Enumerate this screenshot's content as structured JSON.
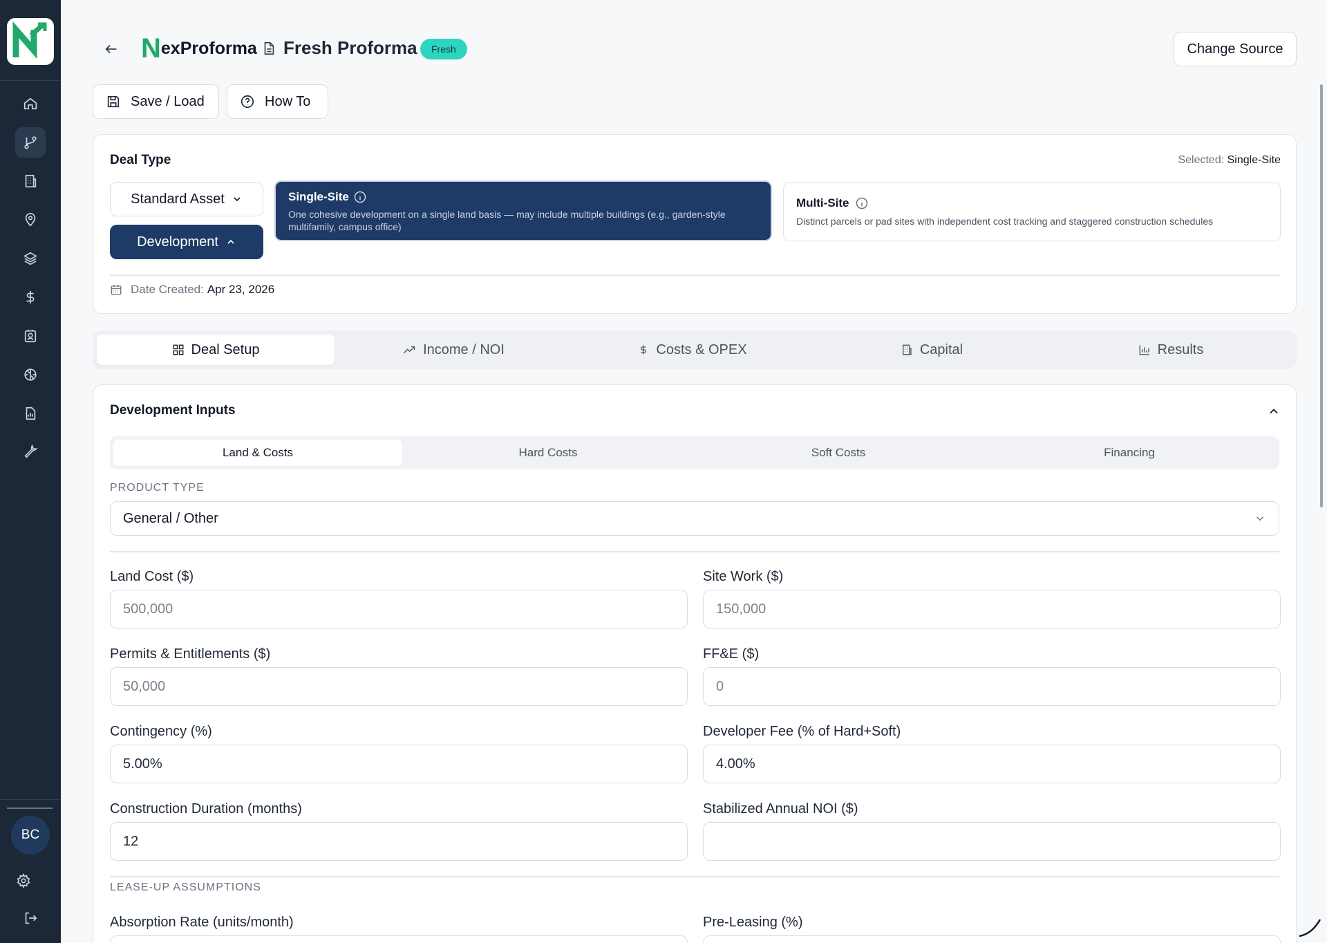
{
  "sidebar": {
    "logo_letter": "N",
    "nav": [
      "home-icon",
      "git-branch-icon",
      "building-icon",
      "map-pin-icon",
      "layers-icon",
      "dollar-icon",
      "badge-icon",
      "brain-icon",
      "report-icon",
      "wrench-icon"
    ],
    "avatar_initials": "BC"
  },
  "header": {
    "brand_n": "N",
    "brand_rest": "exProforma",
    "doc_title": "Fresh Proforma",
    "badge": "Fresh",
    "change_source": "Change Source",
    "save_load": "Save / Load",
    "how_to": "How To"
  },
  "deal": {
    "title": "Deal Type",
    "selected_label": "Selected:",
    "selected_value": "Single-Site",
    "asset_dropdown": "Standard Asset",
    "mode_dropdown": "Development",
    "single_title": "Single-Site",
    "single_desc": "One cohesive development on a single land basis — may include multiple buildings (e.g., garden-style multifamily, campus office)",
    "multi_title": "Multi-Site",
    "multi_desc": "Distinct parcels or pad sites with independent cost tracking and staggered construction schedules",
    "date_label": "Date Created:",
    "date_value": "Apr 23, 2026"
  },
  "tabs": [
    "Deal Setup",
    "Income / NOI",
    "Costs & OPEX",
    "Capital",
    "Results"
  ],
  "dev": {
    "title": "Development Inputs",
    "subtabs": [
      "Land & Costs",
      "Hard Costs",
      "Soft Costs",
      "Financing"
    ],
    "product_type_label": "PRODUCT TYPE",
    "product_type_value": "General / Other",
    "fields": {
      "land_cost": {
        "label": "Land Cost ($)",
        "placeholder": "500,000"
      },
      "site_work": {
        "label": "Site Work ($)",
        "placeholder": "150,000"
      },
      "permits": {
        "label": "Permits & Entitlements ($)",
        "placeholder": "50,000"
      },
      "ffe": {
        "label": "FF&E ($)",
        "placeholder": "0"
      },
      "contingency": {
        "label": "Contingency (%)",
        "value": "5.00%"
      },
      "dev_fee": {
        "label": "Developer Fee (% of Hard+Soft)",
        "value": "4.00%"
      },
      "duration": {
        "label": "Construction Duration (months)",
        "value": "12"
      },
      "noi": {
        "label": "Stabilized Annual NOI ($)",
        "value": ""
      }
    },
    "lease_label": "LEASE-UP ASSUMPTIONS",
    "absorption_label": "Absorption Rate (units/month)",
    "preleasing_label": "Pre-Leasing (%)"
  },
  "colors": {
    "sidebar": "#1c2838",
    "primary": "#1e3a66",
    "accent": "#22a86b",
    "badge": "#2dd4bf"
  }
}
